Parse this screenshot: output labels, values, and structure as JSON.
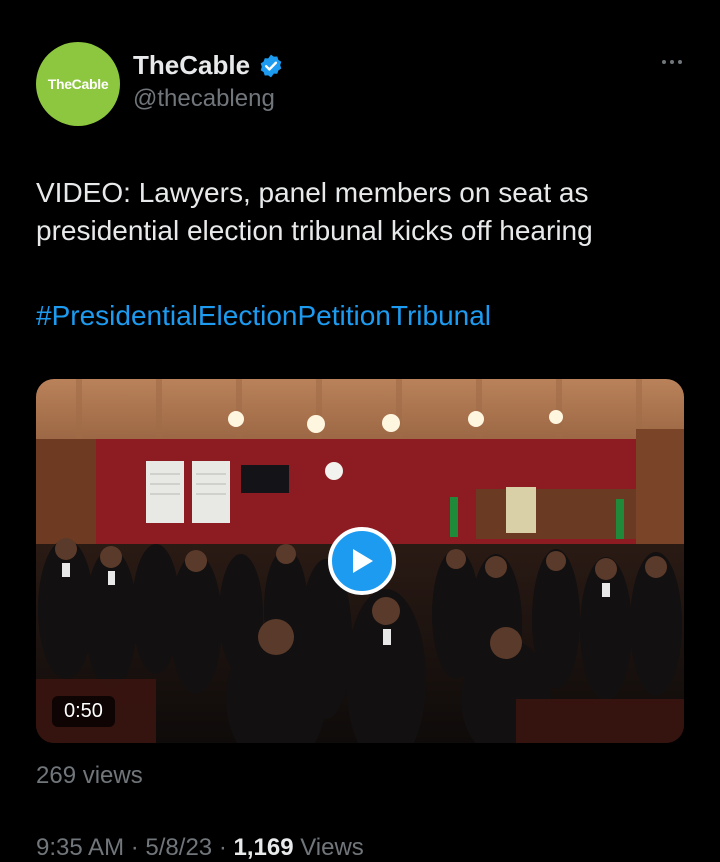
{
  "author": {
    "avatar_text": "TheCable",
    "display_name": "TheCable",
    "handle": "@thecableng",
    "avatar_color": "#8dc63f",
    "verified": true
  },
  "tweet": {
    "text": "VIDEO: Lawyers, panel members on seat as presidential election tribunal kicks off hearing",
    "hashtag": "#PresidentialElectionPetitionTribunal"
  },
  "video": {
    "duration": "0:50",
    "views": "269 views"
  },
  "meta": {
    "time": "9:35 AM",
    "separator": "·",
    "date": "5/8/23",
    "view_count": "1,169",
    "views_label": "Views"
  },
  "colors": {
    "accent": "#1d9bf0",
    "background": "#000000",
    "text": "#e7e9ea",
    "muted": "#71767b"
  },
  "icons": {
    "verified": "verified-badge-icon",
    "more": "more-options-icon",
    "play": "play-icon"
  }
}
